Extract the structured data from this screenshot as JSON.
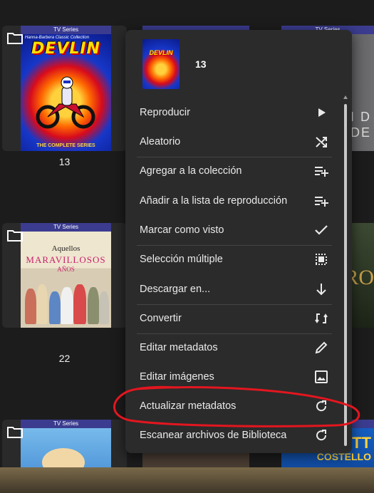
{
  "grid": {
    "badge_text": "TV Series",
    "items": [
      {
        "count": "13",
        "poster": {
          "title": "DEVLIN",
          "top_text": "Hanna-Barbera Classic Collection",
          "bottom_text": "THE COMPLETE SERIES"
        }
      },
      {
        "count": "22",
        "poster": {
          "line1": "Aquellos",
          "line2": "MARAVILLOSOS",
          "line3": "AÑOS"
        }
      },
      {
        "count": "",
        "poster": {}
      }
    ],
    "right_column_texts": [
      "I D",
      "NDE",
      "RO",
      "OTT",
      "COSTELLO"
    ],
    "peek_labels": [
      "TV Series",
      "TV Series"
    ]
  },
  "context_menu": {
    "header": {
      "title": "13",
      "thumb_title": "DEVLIN"
    },
    "items": [
      {
        "label": "Reproducir",
        "icon": "play-icon"
      },
      {
        "label": "Aleatorio",
        "icon": "shuffle-icon"
      },
      {
        "label": "Agregar a la colección",
        "icon": "playlist-add-icon"
      },
      {
        "label": "Añadir a la lista de reproducción",
        "icon": "playlist-add-icon"
      },
      {
        "label": "Marcar como visto",
        "icon": "check-icon"
      },
      {
        "label": "Selección múltiple",
        "icon": "select-all-icon"
      },
      {
        "label": "Descargar en...",
        "icon": "download-arrow-icon"
      },
      {
        "label": "Convertir",
        "icon": "convert-icon"
      },
      {
        "label": "Editar metadatos",
        "icon": "pencil-icon"
      },
      {
        "label": "Editar imágenes",
        "icon": "image-icon"
      },
      {
        "label": "Actualizar metadatos",
        "icon": "refresh-icon"
      },
      {
        "label": "Escanear archivos de Biblioteca",
        "icon": "refresh-icon"
      }
    ]
  },
  "colors": {
    "menu_bg": "#2b2b2b",
    "badge_bg": "#3b3c8f",
    "annotation": "#e3161f"
  }
}
